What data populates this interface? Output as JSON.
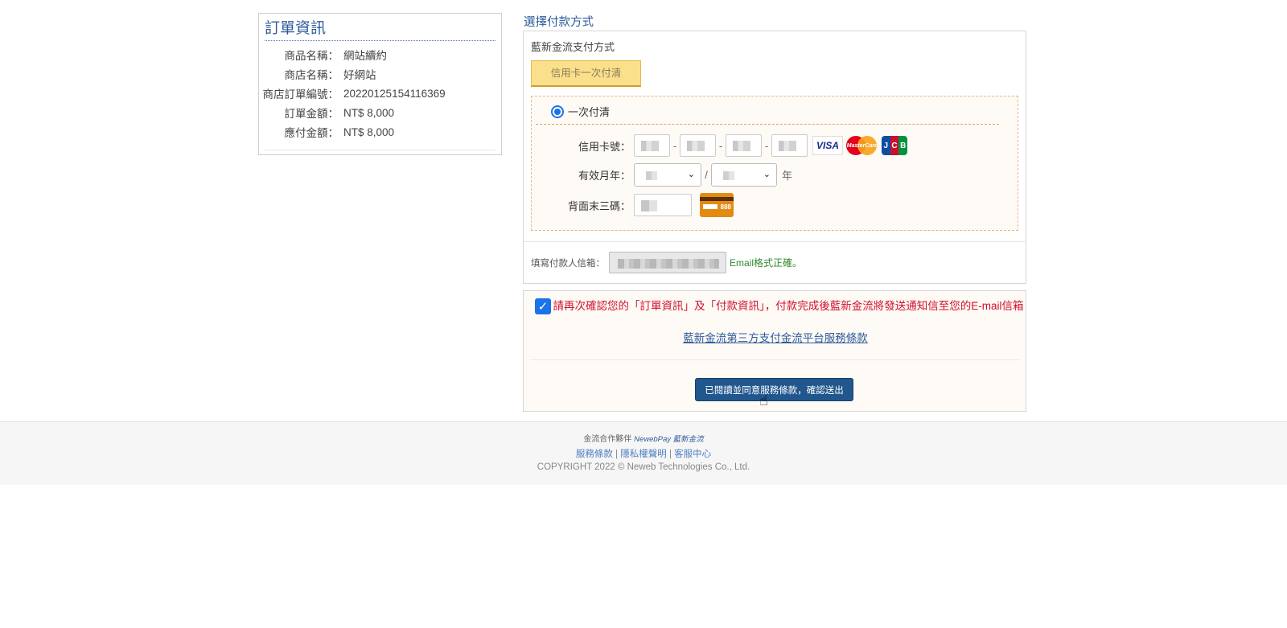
{
  "order": {
    "title": "訂單資訊",
    "rows": [
      {
        "label": "商品名稱：",
        "value": "網站續約"
      },
      {
        "label": "商店名稱：",
        "value": "好網站"
      },
      {
        "label": "商店訂單編號：",
        "value": "20220125154116369"
      },
      {
        "label": "訂單金額：",
        "value": "NT$ 8,000"
      },
      {
        "label": "應付金額：",
        "value": "NT$ 8,000"
      }
    ]
  },
  "payment": {
    "heading": "選擇付款方式",
    "provider_label": "藍新金流支付方式",
    "method_button": "信用卡一次付清",
    "option_label": "一次付清",
    "card_number_label": "信用卡號：",
    "card_sep": "-",
    "expiry_label": "有效月年：",
    "expiry_sep": "/",
    "year_unit": "年",
    "cvv_label": "背面末三碼：",
    "cvv_card_text": "888",
    "brands": {
      "visa": "VISA",
      "mastercard": "MasterCard",
      "jcb": [
        "J",
        "C",
        "B"
      ]
    },
    "email_label": "填寫付款人信箱：",
    "email_status": "Email格式正確。"
  },
  "confirm": {
    "checked": true,
    "text": "請再次確認您的「訂單資訊」及「付款資訊」，付款完成後藍新金流將發送通知信至您的E-mail信箱",
    "terms_link": "藍新金流第三方支付金流平台服務條款",
    "submit_button": "已閱讀並同意服務條款，確認送出"
  },
  "footer": {
    "partner_label": "金流合作夥伴",
    "partner_brand": "NewebPay 藍新金流",
    "links": [
      "服務條款",
      "隱私權聲明",
      "客服中心"
    ],
    "link_sep": " | ",
    "copyright": "COPYRIGHT 2022 © Neweb Technologies Co., Ltd."
  },
  "colors": {
    "accent": "#2d5a9a",
    "warning_text": "#d0112b",
    "success_text": "#2f8a2f",
    "method_button_bg": "#fbe08b",
    "submit_bg": "#21578d"
  }
}
